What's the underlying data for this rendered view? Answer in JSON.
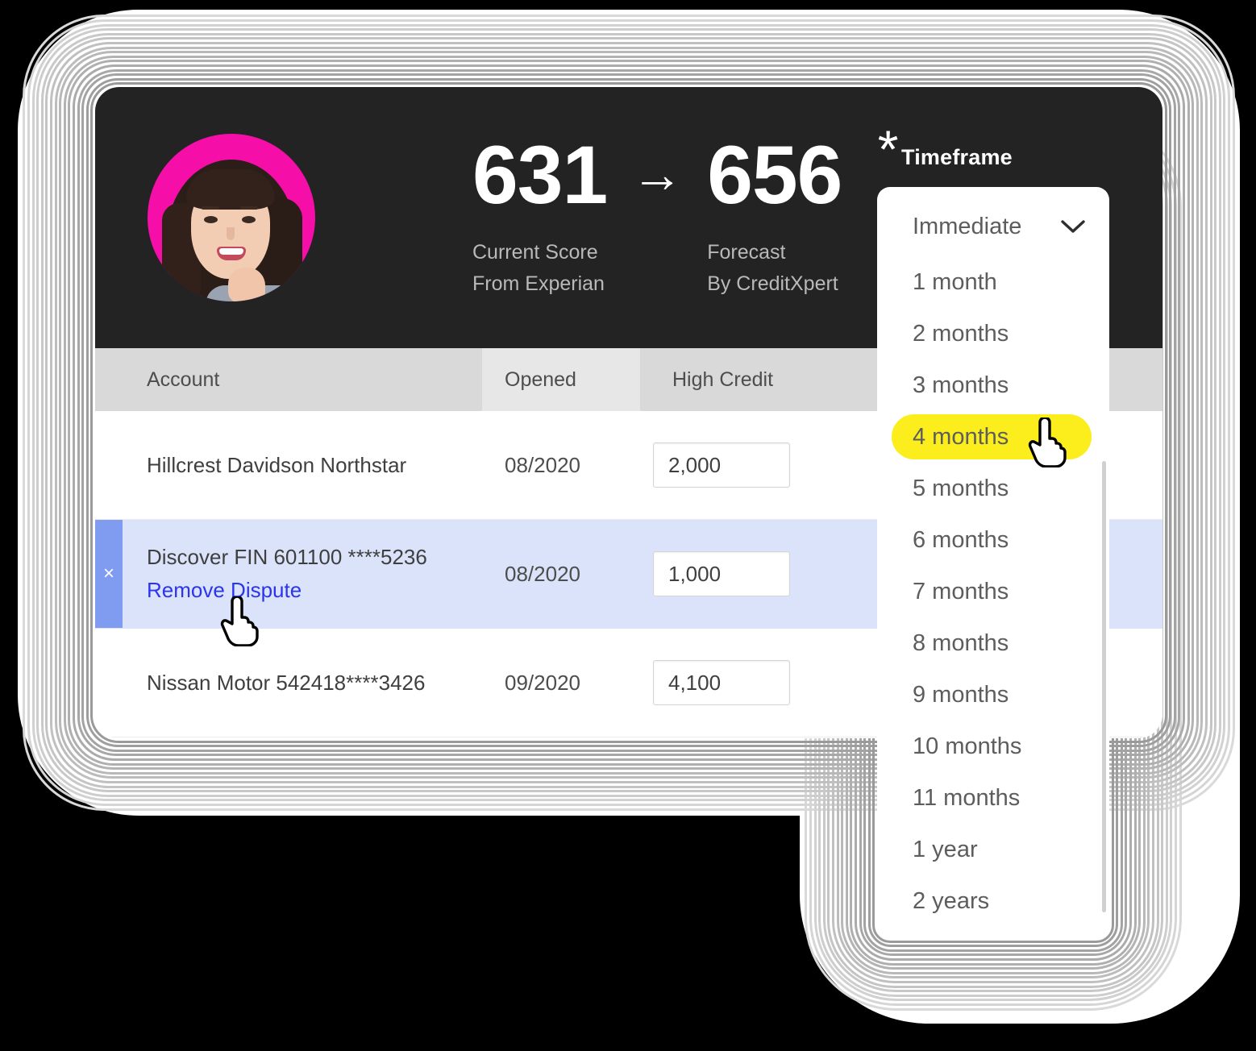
{
  "header": {
    "current_score": "631",
    "arrow": "→",
    "forecast_score": "656",
    "asterisk": "*",
    "current_label_line1": "Current Score",
    "current_label_line2": "From Experian",
    "forecast_label_line1": "Forecast",
    "forecast_label_line2": "By CreditXpert",
    "timeframe_label": "Timeframe",
    "avatar_alt": "user-avatar",
    "bg_color": "#232323",
    "avatar_ring_color": "#f50fa8"
  },
  "table": {
    "columns": [
      "Account",
      "Opened",
      "High Credit"
    ],
    "rows": [
      {
        "account": "Hillcrest Davidson Northstar",
        "link": "",
        "opened": "08/2020",
        "high_credit": "2,000",
        "selected": false,
        "close_icon": ""
      },
      {
        "account": "Discover FIN 601100 ****5236",
        "link": "Remove Dispute",
        "opened": "08/2020",
        "high_credit": "1,000",
        "selected": true,
        "close_icon": "×"
      },
      {
        "account": "Nissan Motor 542418****3426",
        "link": "",
        "opened": "09/2020",
        "high_credit": "4,100",
        "selected": false,
        "close_icon": ""
      }
    ],
    "header_bg": "#d9d9d9",
    "selected_row_bg": "#dae3f9",
    "selected_accent": "#7f9cf0",
    "link_color": "#2b35ee"
  },
  "dropdown": {
    "selected_value": "Immediate",
    "chevron_icon": "chevron-down-icon",
    "highlight_color": "#fbee1c",
    "highlighted_option": "4 months",
    "options": [
      "1 month",
      "2 months",
      "3 months",
      "4 months",
      "5 months",
      "6 months",
      "7 months",
      "8 months",
      "9 months",
      "10 months",
      "11 months",
      "1 year",
      "2 years"
    ]
  },
  "cursors": {
    "dropdown_cursor": "pointer-hand-cursor",
    "row_cursor": "pointer-hand-cursor"
  }
}
